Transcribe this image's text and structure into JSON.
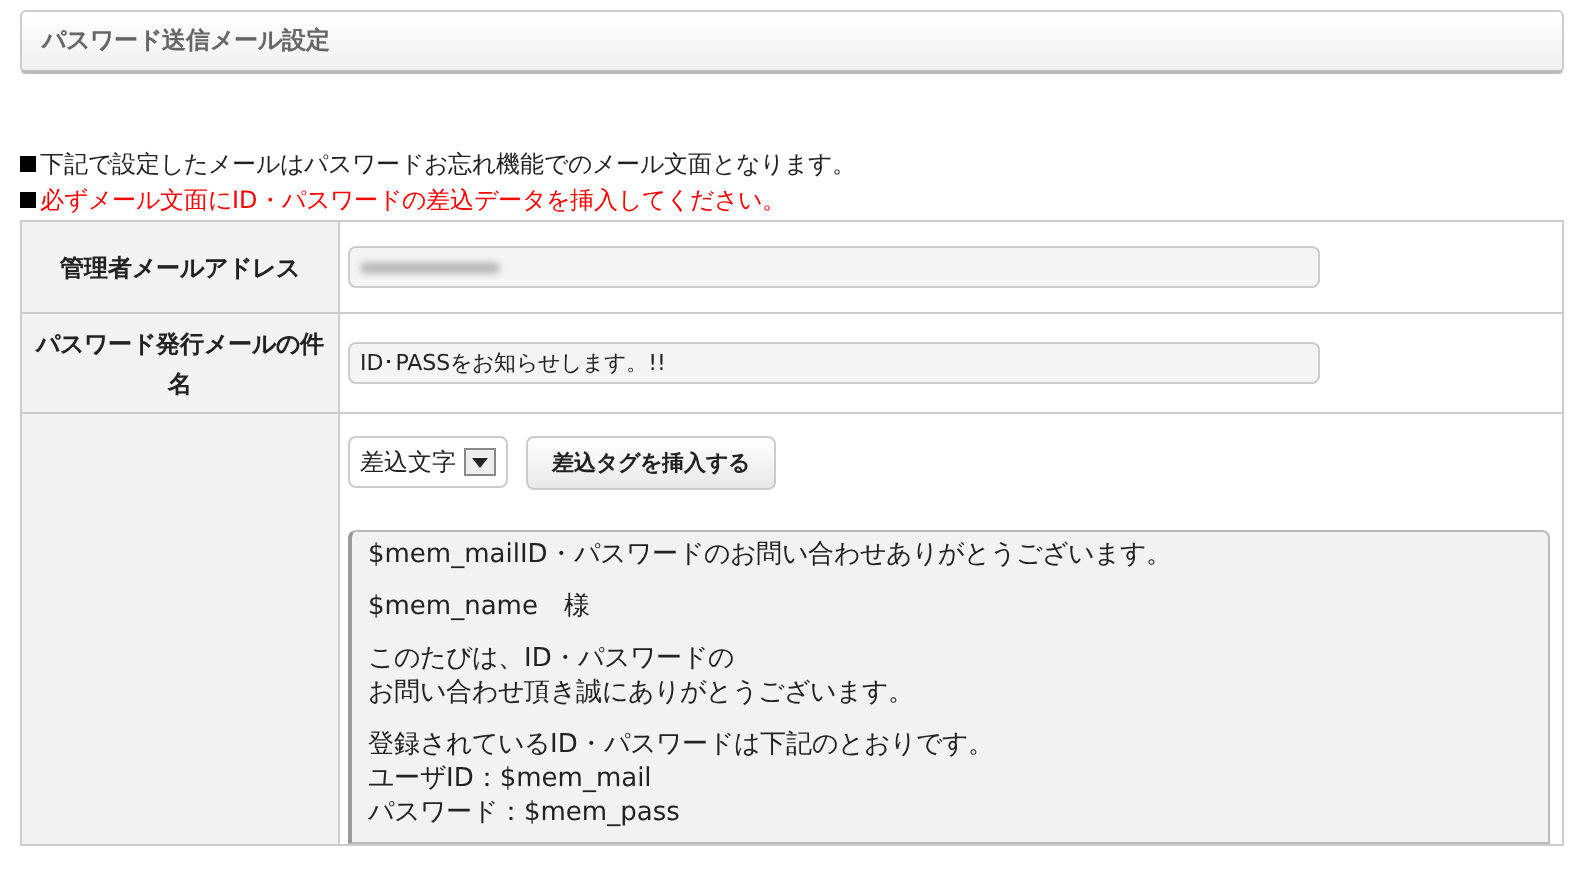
{
  "panel_title": "パスワード送信メール設定",
  "notes": [
    {
      "kind": "normal",
      "text": "下記で設定したメールはパスワードお忘れ機能でのメール文面となります。"
    },
    {
      "kind": "warning",
      "text": "必ずメール文面にID・パスワードの差込データを挿入してください。"
    }
  ],
  "form": [
    {
      "label": "管理者メールアドレス",
      "kind": "blurred"
    },
    {
      "label": "パスワード発行メールの件名",
      "kind": "text",
      "value": "ID･PASSをお知らせします。!!"
    },
    {
      "kind": "body",
      "select": {
        "value": "差込文字"
      },
      "insert_button": "差込タグを挿入する",
      "body_paragraphs": [
        [
          "$mem_mailID・パスワードのお問い合わせありがとうございます。"
        ],
        [
          "$mem_name　様"
        ],
        [
          "このたびは、ID・パスワードの",
          "お問い合わせ頂き誠にありがとうございます。"
        ],
        [
          "登録されているID・パスワードは下記のとおりです。",
          "ユーザID：$mem_mail",
          "パスワード：$mem_pass"
        ]
      ]
    }
  ]
}
